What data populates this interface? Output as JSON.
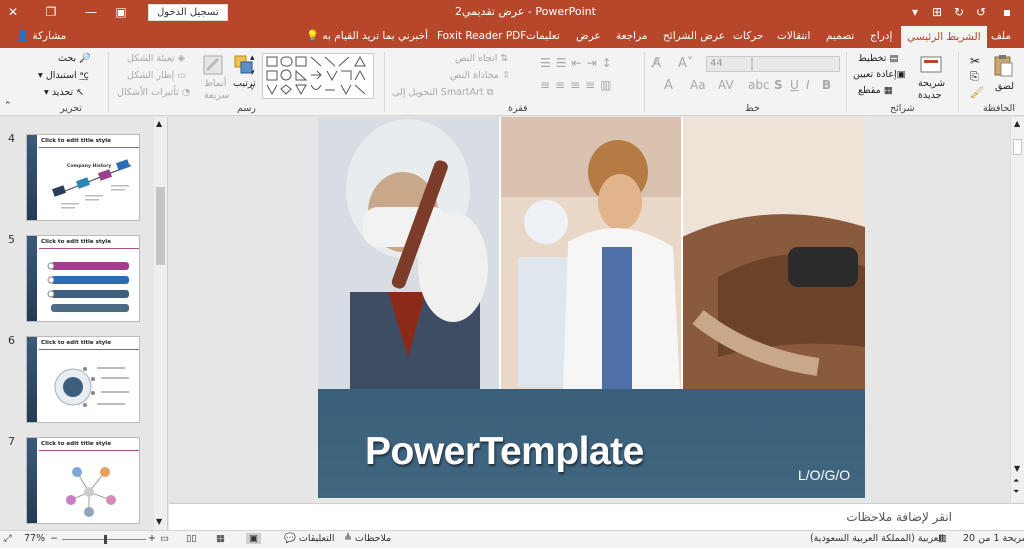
{
  "titlebar": {
    "doc_title": "عرض تقديمي2 - PowerPoint",
    "signin": "تسجيل الدخول"
  },
  "tabs": {
    "file": "ملف",
    "home": "الشريط الرئيسي",
    "insert": "إدراج",
    "design": "تصميم",
    "transitions": "انتقالات",
    "animations": "حركات",
    "slideshow": "عرض الشرائح",
    "review": "مراجعة",
    "view": "عرض",
    "help": "تعليمات",
    "foxit": "Foxit Reader PDF",
    "tellme": "أخبرني بما تريد القيام به",
    "share": "مشاركة"
  },
  "ribbon": {
    "clipboard": {
      "label": "الحافظة",
      "paste": "لصق"
    },
    "slides": {
      "label": "شرائح",
      "new_slide": "شريحة",
      "new_slide2": "جديدة",
      "layout": "تخطيط",
      "reset": "إعادة تعيين",
      "section": "مقطع"
    },
    "font": {
      "label": "خط",
      "size": "44"
    },
    "paragraph": {
      "label": "فقرة",
      "text_direction": "اتجاه النص",
      "align_text": "محاذاة النص",
      "smartart": "التحويل إلى SmartArt"
    },
    "drawing": {
      "label": "رسم",
      "arrange": "ترتيب",
      "styles": "أنماط",
      "styles2": "سريعة",
      "fill": "تعبئة الشكل",
      "outline": "إطار الشكل",
      "effects": "تأثيرات الأشكال"
    },
    "editing": {
      "label": "تحرير",
      "find": "بحث",
      "replace": "استبدال",
      "select": "تحديد"
    }
  },
  "thumbnails": [
    {
      "num": "4",
      "title": "Click to edit title style",
      "caption": "Company History"
    },
    {
      "num": "5",
      "title": "Click to edit title style"
    },
    {
      "num": "6",
      "title": "Click to edit title style"
    },
    {
      "num": "7",
      "title": "Click to edit title style"
    }
  ],
  "slide": {
    "title": "PowerTemplate",
    "logo": "L/O/G/O"
  },
  "notes": {
    "placeholder": "انقر لإضافة ملاحظات"
  },
  "status": {
    "slide_info": "شريحة 1 من 20",
    "language": "العربية (المملكة العربية السعودية)",
    "notes": "ملاحظات",
    "comments": "التعليقات",
    "zoom": "77%"
  },
  "colors": {
    "accent": "#b7472a",
    "slide_band": "#3e637d"
  }
}
